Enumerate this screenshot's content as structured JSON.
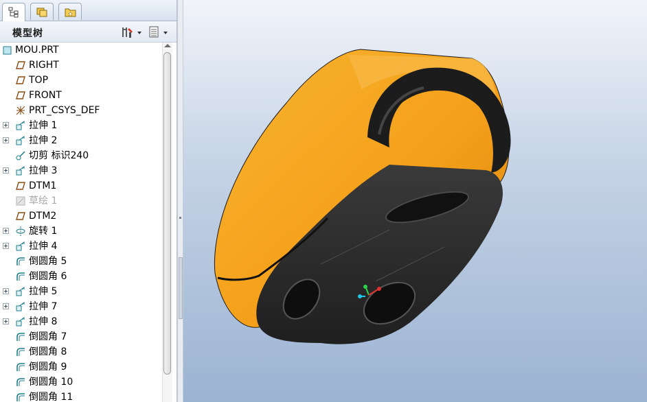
{
  "tabs": [
    {
      "icon": "model-tree-tab-icon"
    },
    {
      "icon": "folder-browser-tab-icon"
    },
    {
      "icon": "favorites-tab-icon"
    }
  ],
  "header": {
    "title": "模型树",
    "settings_icon": "tree-settings-icon",
    "columns_icon": "tree-columns-icon"
  },
  "tree": {
    "items": [
      {
        "label": "MOU.PRT",
        "icon": "part-icon",
        "expandable": false,
        "dim": false
      },
      {
        "label": "RIGHT",
        "icon": "datum-plane-icon",
        "expandable": false,
        "dim": false
      },
      {
        "label": "TOP",
        "icon": "datum-plane-icon",
        "expandable": false,
        "dim": false
      },
      {
        "label": "FRONT",
        "icon": "datum-plane-icon",
        "expandable": false,
        "dim": false
      },
      {
        "label": "PRT_CSYS_DEF",
        "icon": "csys-icon",
        "expandable": false,
        "dim": false
      },
      {
        "label": "拉伸 1",
        "icon": "extrude-icon",
        "expandable": true,
        "dim": false
      },
      {
        "label": "拉伸 2",
        "icon": "extrude-icon",
        "expandable": true,
        "dim": false
      },
      {
        "label": "切剪 标识240",
        "icon": "cut-icon",
        "expandable": false,
        "dim": false
      },
      {
        "label": "拉伸 3",
        "icon": "extrude-icon",
        "expandable": true,
        "dim": false
      },
      {
        "label": "DTM1",
        "icon": "datum-plane-icon",
        "expandable": false,
        "dim": false
      },
      {
        "label": "草绘 1",
        "icon": "sketch-icon",
        "expandable": false,
        "dim": true
      },
      {
        "label": "DTM2",
        "icon": "datum-plane-icon",
        "expandable": false,
        "dim": false
      },
      {
        "label": "旋转 1",
        "icon": "revolve-icon",
        "expandable": true,
        "dim": false
      },
      {
        "label": "拉伸 4",
        "icon": "extrude-icon",
        "expandable": true,
        "dim": false
      },
      {
        "label": "倒圆角 5",
        "icon": "round-icon",
        "expandable": false,
        "dim": false
      },
      {
        "label": "倒圆角 6",
        "icon": "round-icon",
        "expandable": false,
        "dim": false
      },
      {
        "label": "拉伸 5",
        "icon": "extrude-icon",
        "expandable": true,
        "dim": false
      },
      {
        "label": "拉伸 7",
        "icon": "extrude-icon",
        "expandable": true,
        "dim": false
      },
      {
        "label": "拉伸 8",
        "icon": "extrude-icon",
        "expandable": true,
        "dim": false
      },
      {
        "label": "倒圆角 7",
        "icon": "round-icon",
        "expandable": false,
        "dim": false
      },
      {
        "label": "倒圆角 8",
        "icon": "round-icon",
        "expandable": false,
        "dim": false
      },
      {
        "label": "倒圆角 9",
        "icon": "round-icon",
        "expandable": false,
        "dim": false
      },
      {
        "label": "倒圆角 10",
        "icon": "round-icon",
        "expandable": false,
        "dim": false
      },
      {
        "label": "倒圆角 11",
        "icon": "round-icon",
        "expandable": false,
        "dim": false
      }
    ]
  },
  "colors": {
    "shell": "#f5a01a",
    "base": "#2a2a2a",
    "viewport_top": "#f1f4fa",
    "viewport_bottom": "#9bb3d2",
    "datum_icon": "#8a4a12",
    "feature_icon": "#1d7d8c"
  }
}
